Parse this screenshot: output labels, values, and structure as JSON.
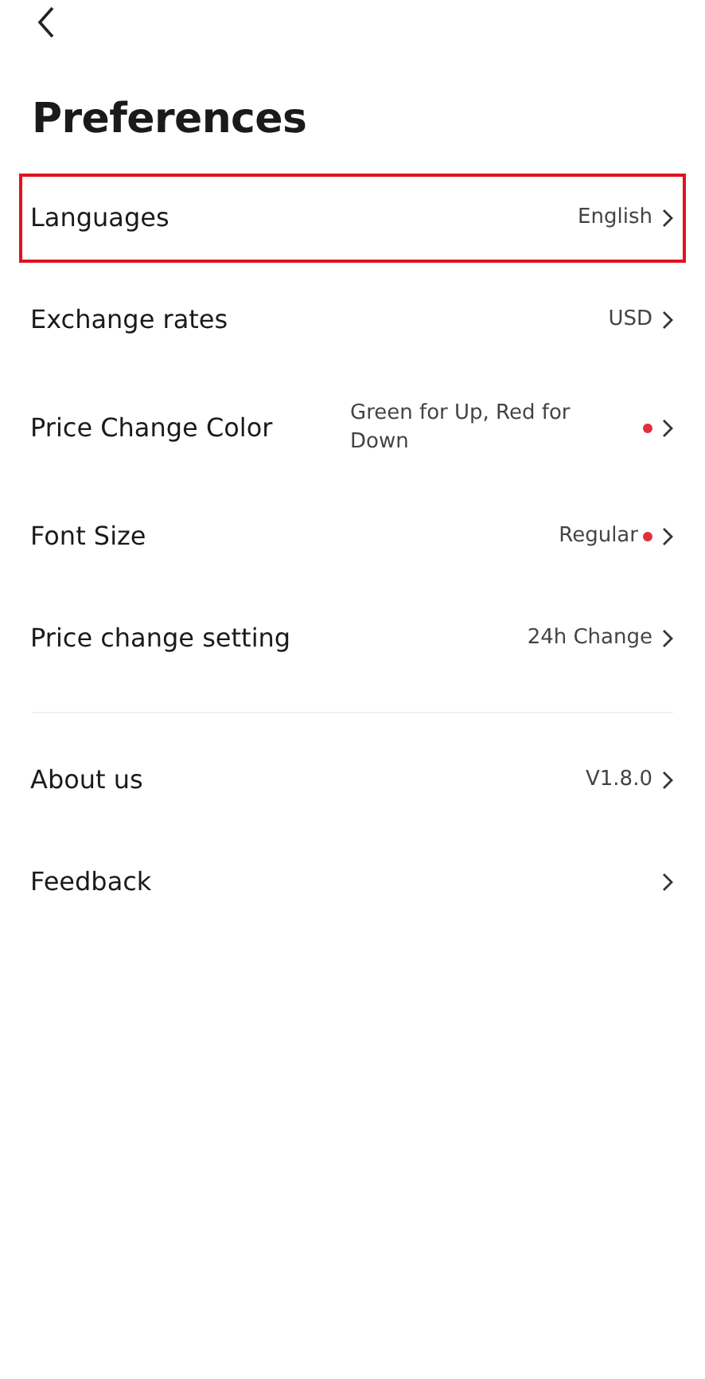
{
  "title": "Preferences",
  "groups": [
    {
      "items": [
        {
          "label": "Languages",
          "value": "English",
          "dot": false,
          "highlighted": true
        },
        {
          "label": "Exchange rates",
          "value": "USD",
          "dot": false,
          "highlighted": false
        },
        {
          "label": "Price Change Color",
          "value": "Green for Up, Red for Down",
          "dot": true,
          "highlighted": false
        },
        {
          "label": "Font Size",
          "value": "Regular",
          "dot": true,
          "highlighted": false
        },
        {
          "label": "Price change setting",
          "value": "24h Change",
          "dot": false,
          "highlighted": false
        }
      ]
    },
    {
      "items": [
        {
          "label": "About us",
          "value": "V1.8.0",
          "dot": false,
          "highlighted": false
        },
        {
          "label": "Feedback",
          "dot": false,
          "highlighted": false
        }
      ]
    }
  ]
}
